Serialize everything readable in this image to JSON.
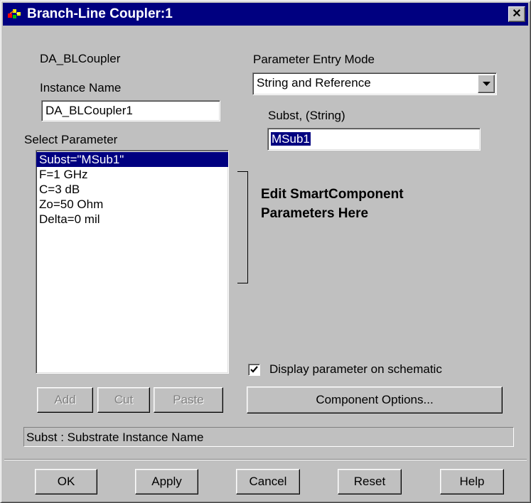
{
  "window": {
    "title": "Branch-Line Coupler:1",
    "close_glyph": "✕"
  },
  "component": {
    "model_name": "DA_BLCoupler",
    "instance_label": "Instance Name",
    "instance_value": "DA_BLCoupler1"
  },
  "parameter_entry": {
    "label": "Parameter Entry Mode",
    "selected": "String and Reference"
  },
  "param_edit": {
    "label": "Subst, (String)",
    "value": "MSub1"
  },
  "select_parameter": {
    "label": "Select Parameter",
    "items": [
      {
        "text": "Subst=\"MSub1\""
      },
      {
        "text": "F=1 GHz"
      },
      {
        "text": "C=3 dB"
      },
      {
        "text": "Zo=50 Ohm"
      },
      {
        "text": "Delta=0 mil"
      }
    ]
  },
  "annotation": {
    "line1": "Edit SmartComponent",
    "line2": "Parameters Here"
  },
  "list_buttons": {
    "add": "Add",
    "cut": "Cut",
    "paste": "Paste"
  },
  "display_checkbox": {
    "label": "Display parameter on schematic",
    "checked": true
  },
  "component_options_label": "Component Options...",
  "status_text": "Subst : Substrate Instance Name",
  "footer": {
    "ok": "OK",
    "apply": "Apply",
    "cancel": "Cancel",
    "reset": "Reset",
    "help": "Help"
  },
  "icons": {
    "app": "app-icon",
    "close": "close-icon",
    "dropdown": "chevron-down-icon",
    "check": "check-icon"
  },
  "colors": {
    "titlebar": "#000080",
    "dialog_bg": "#c0c0c0",
    "selection": "#000080"
  }
}
